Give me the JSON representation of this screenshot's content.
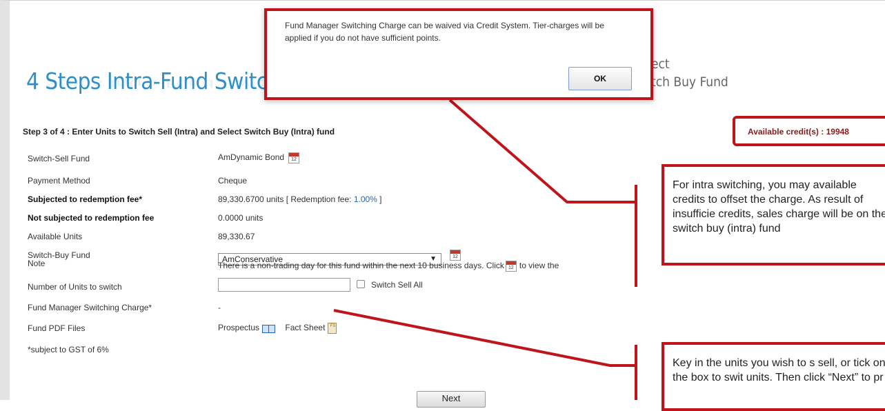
{
  "banner": {
    "title": "4 Steps Intra-Fund Switch",
    "right_line1": "ect",
    "right_line2": "tch Buy Fund"
  },
  "step": {
    "title": "Step 3 of 4 : Enter Units to Switch Sell (Intra) and Select Switch Buy (Intra) fund",
    "available_credits": "Available credit(s) : 19948"
  },
  "form": {
    "switch_sell_label": "Switch-Sell Fund",
    "switch_sell_value": "AmDynamic Bond",
    "payment_label": "Payment Method",
    "payment_value": "Cheque",
    "subjected_label": "Subjected to redemption fee*",
    "subjected_value": "89,330.6700 units [ Redemption fee: ",
    "subjected_fee": "1.00%",
    "subjected_close": " ]",
    "not_subjected_label": "Not subjected to redemption fee",
    "not_subjected_value": "0.0000 units",
    "available_units_label": "Available Units",
    "available_units_value": "89,330.67",
    "switch_buy_label": "Switch-Buy Fund",
    "switch_buy_selected": "AmConservative",
    "note_label": "Note",
    "note_value_a": "There is a non-trading day for this fund within the next 10 business days. Click",
    "note_value_b": "to view the",
    "units_label": "Number of Units to switch",
    "units_value": "",
    "switch_sell_all_label": "Switch Sell All",
    "fm_charge_label": "Fund Manager Switching Charge*",
    "fm_charge_value": "-",
    "pdf_label": "Fund PDF Files",
    "prospectus": "Prospectus",
    "fact_sheet": "Fact Sheet",
    "gst_note": "*subject to GST of 6%",
    "next_button": "Next",
    "calendar_day": "12",
    "fs_badge": "FS"
  },
  "dialog": {
    "message": "Fund Manager Switching Charge can be waived via Credit System. Tier-charges will be applied if you do not have sufficient points.",
    "ok": "OK"
  },
  "callouts": {
    "credits": "For intra switching, you may available credits to offset the charge. As result of insufficie credits, sales charge will be on the switch buy (intra) fund",
    "units": "Key in the units you wish to s sell, or tick on the box to swit units. Then click “Next” to pr"
  },
  "colors": {
    "accent_red": "#c0141b",
    "title_blue": "#2e8fc6",
    "credit_text": "#8b1a1a"
  }
}
